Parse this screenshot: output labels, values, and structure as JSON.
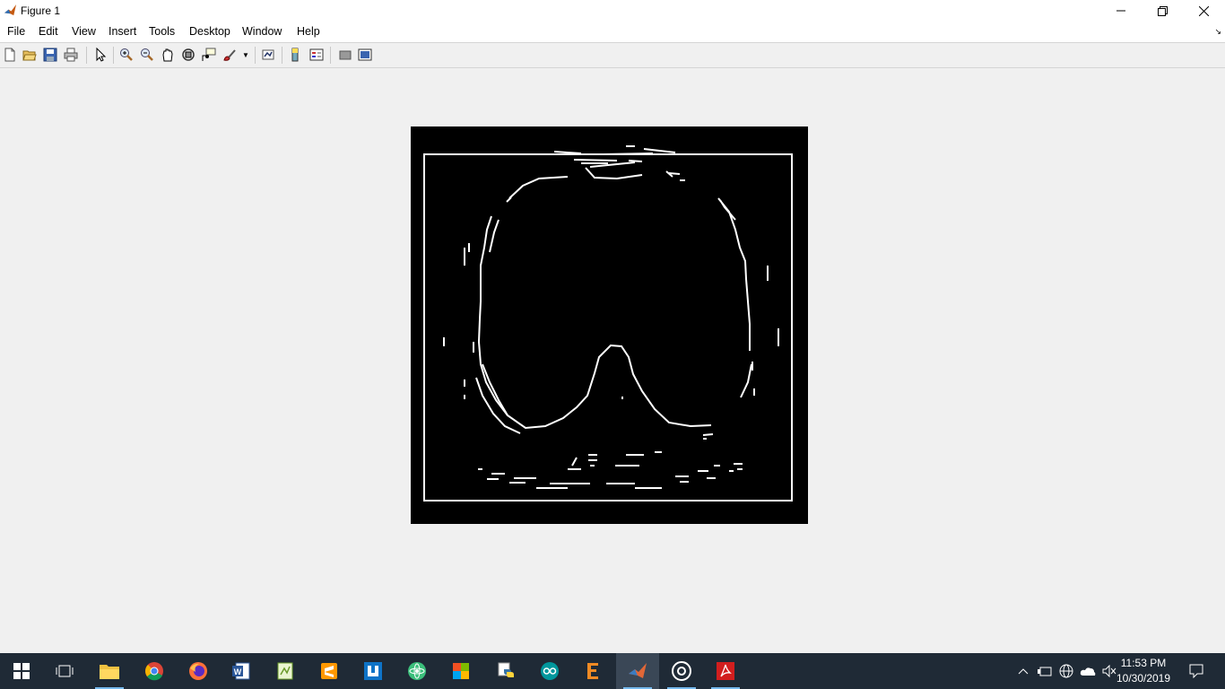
{
  "window": {
    "title": "Figure 1"
  },
  "menu": [
    "File",
    "Edit",
    "View",
    "Insert",
    "Tools",
    "Desktop",
    "Window",
    "Help"
  ],
  "toolbar": {
    "tools": [
      "new-figure-icon",
      "open-file-icon",
      "save-icon",
      "print-icon",
      "pointer-icon",
      "zoom-in-icon",
      "zoom-out-icon",
      "pan-icon",
      "rotate-3d-icon",
      "data-cursor-icon",
      "brush-icon",
      "link-plot-icon",
      "colorbar-icon",
      "legend-icon",
      "hide-plot-tools-icon",
      "show-plot-tools-icon"
    ]
  },
  "taskbar": {
    "apps": [
      "start-icon",
      "task-view-icon",
      "file-explorer-icon",
      "chrome-icon",
      "firefox-icon",
      "word-icon",
      "notepad-plus-icon",
      "sublime-icon",
      "app-icon",
      "atom-icon",
      "office-icon",
      "python-icon",
      "arduino-icon",
      "eclipse-icon",
      "matlab-icon",
      "obs-icon",
      "acrobat-icon"
    ],
    "time": "11:53 PM",
    "date": "10/30/2019"
  },
  "colors": {
    "taskbar": "#1f2a36",
    "figure_bg": "#f0f0f0",
    "image_bg": "#000000",
    "edge": "#ffffff"
  }
}
